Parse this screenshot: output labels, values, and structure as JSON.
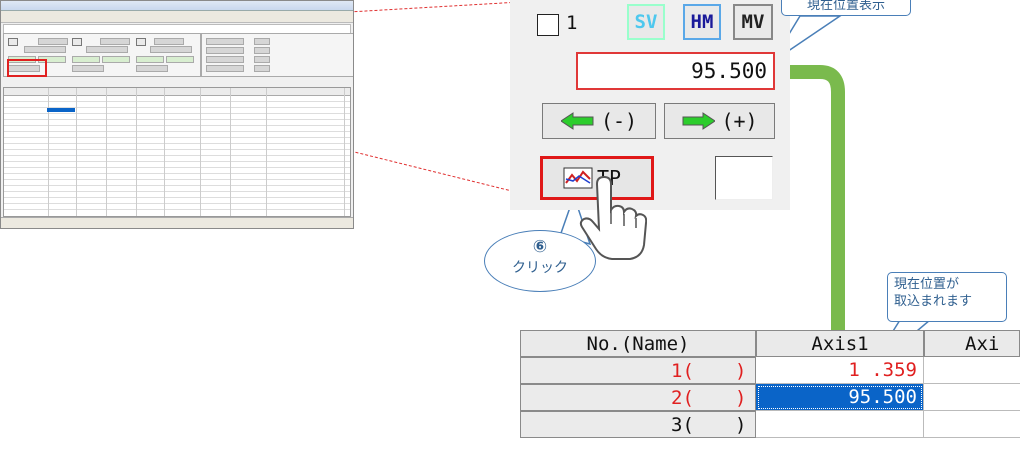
{
  "control_panel": {
    "checkbox_label": "1",
    "mode_buttons": [
      {
        "label": "SV",
        "color": "#4ec8ee"
      },
      {
        "label": "HM",
        "color": "#1a1a9a"
      },
      {
        "label": "MV",
        "color": "#222222"
      }
    ],
    "current_position": "95.500",
    "jog_minus_label": "(-)",
    "jog_plus_label": "(+)",
    "teach_button_label": "TP"
  },
  "callouts": {
    "current_position_display": "現在位置表示",
    "step_number": "⑥",
    "click_label": "クリック",
    "position_loaded": "現在位置が\n取込まれます"
  },
  "table": {
    "headers": [
      "No.(Name)",
      "Axis1",
      "Axi"
    ],
    "rows": [
      {
        "no": "1(",
        "close": ")",
        "axis1": "1 .359",
        "axis1_color": "#e02020"
      },
      {
        "no": "2(",
        "close": ")",
        "axis1": "95.500",
        "selected": true
      },
      {
        "no": "3(",
        "close": ")",
        "axis1": ""
      }
    ]
  },
  "colors": {
    "accent_red": "#e02020",
    "callout_blue": "#4a7fb8",
    "arrow_green": "#6bb23a",
    "selection_blue": "#0a64c8"
  }
}
